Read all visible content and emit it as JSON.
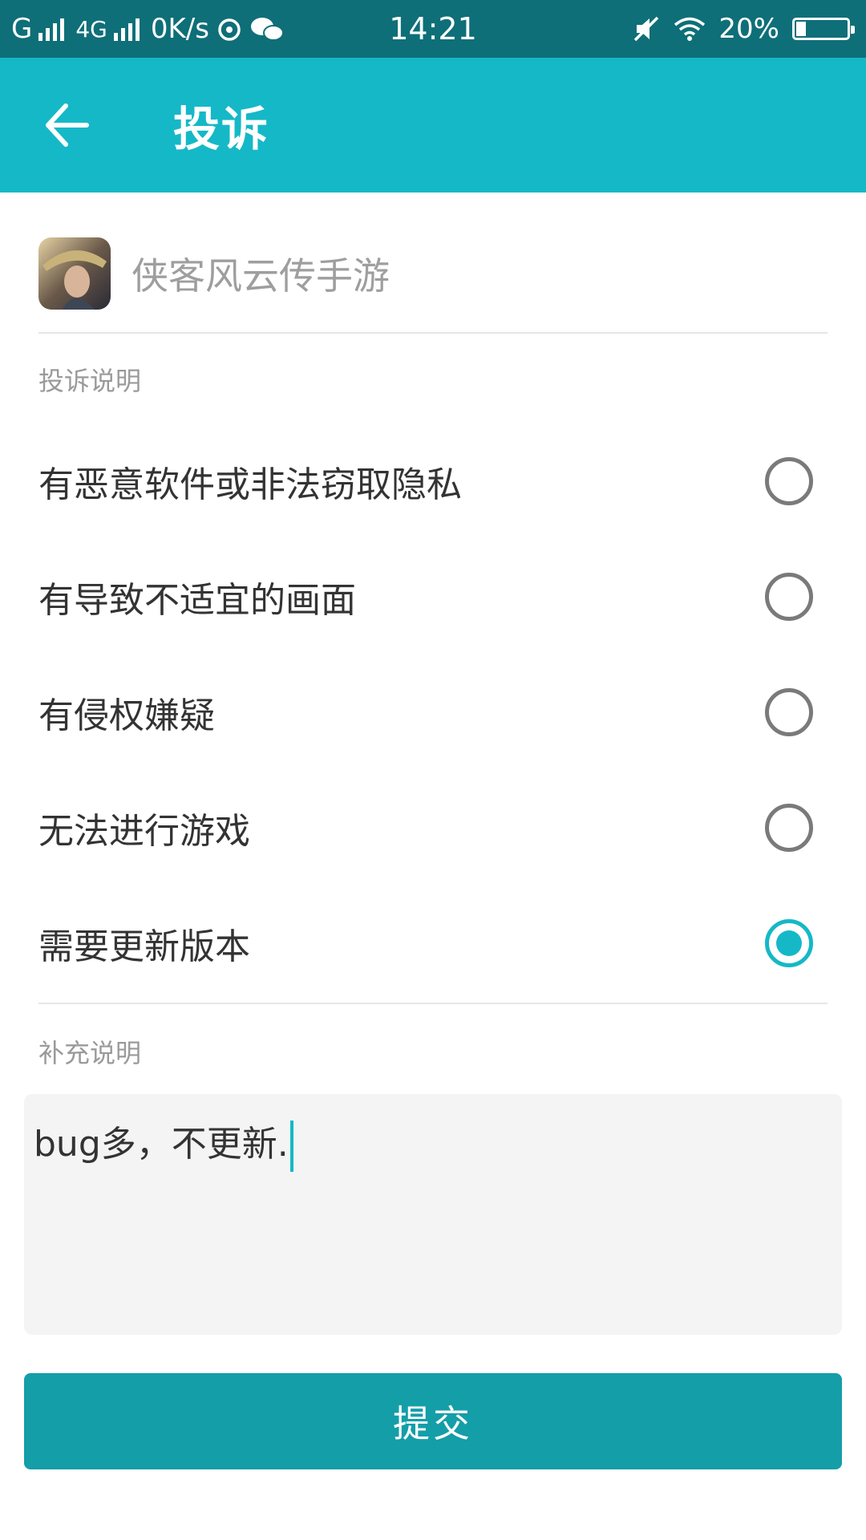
{
  "status_bar": {
    "carrier1": "G",
    "network2": "4G",
    "speed": "0K/s",
    "time": "14:21",
    "battery": "20%",
    "battery_level": 0.2
  },
  "header": {
    "title": "投诉"
  },
  "game": {
    "name": "侠客风云传手游"
  },
  "complaint": {
    "label": "投诉说明",
    "options": [
      {
        "label": "有恶意软件或非法窃取隐私",
        "selected": false
      },
      {
        "label": "有导致不适宜的画面",
        "selected": false
      },
      {
        "label": "有侵权嫌疑",
        "selected": false
      },
      {
        "label": "无法进行游戏",
        "selected": false
      },
      {
        "label": "需要更新版本",
        "selected": true
      }
    ]
  },
  "supplement": {
    "label": "补充说明",
    "value": "bug多，不更新."
  },
  "submit_label": "提交",
  "colors": {
    "accent": "#15b8c7",
    "status_bar": "#0e6f78",
    "button": "#149ea8"
  }
}
